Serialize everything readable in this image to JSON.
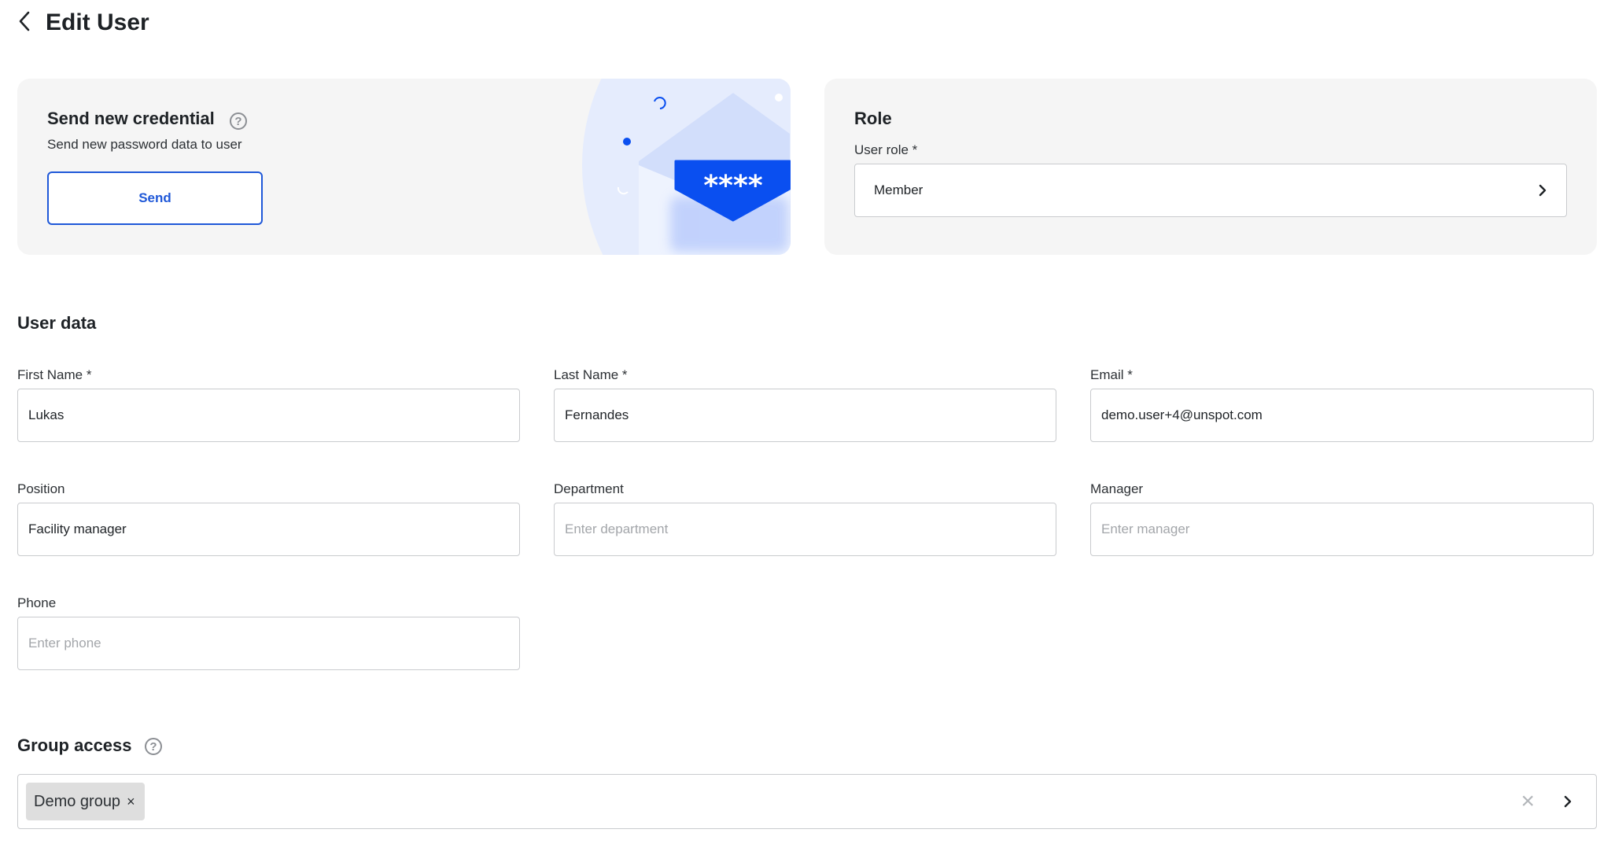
{
  "header": {
    "title": "Edit User",
    "back_icon": "chevron-left-icon"
  },
  "credential_card": {
    "title": "Send new credential",
    "help_glyph": "?",
    "subtitle": "Send new password data to user",
    "send_label": "Send",
    "envelope_mask": "****",
    "colors": {
      "accent": "#0a4ff0",
      "card_bg": "#f5f5f5",
      "illustration_bg": "#e5ecfd"
    }
  },
  "role_card": {
    "title": "Role",
    "user_role_label": "User role *",
    "user_role_value": "Member",
    "chevron_icon": "chevron-right-icon"
  },
  "user_data": {
    "title": "User data",
    "fields": {
      "first_name": {
        "label": "First Name *",
        "value": "Lukas",
        "placeholder": ""
      },
      "last_name": {
        "label": "Last Name *",
        "value": "Fernandes",
        "placeholder": ""
      },
      "email": {
        "label": "Email *",
        "value": "demo.user+4@unspot.com",
        "placeholder": ""
      },
      "position": {
        "label": "Position",
        "value": "Facility manager",
        "placeholder": ""
      },
      "department": {
        "label": "Department",
        "value": "",
        "placeholder": "Enter department"
      },
      "manager": {
        "label": "Manager",
        "value": "",
        "placeholder": "Enter manager"
      },
      "phone": {
        "label": "Phone",
        "value": "",
        "placeholder": "Enter phone"
      }
    }
  },
  "group_access": {
    "title": "Group access",
    "help_glyph": "?",
    "chips": [
      {
        "label": "Demo group",
        "remove_glyph": "×"
      }
    ],
    "clear_glyph": "×",
    "chevron_icon": "chevron-right-icon"
  }
}
